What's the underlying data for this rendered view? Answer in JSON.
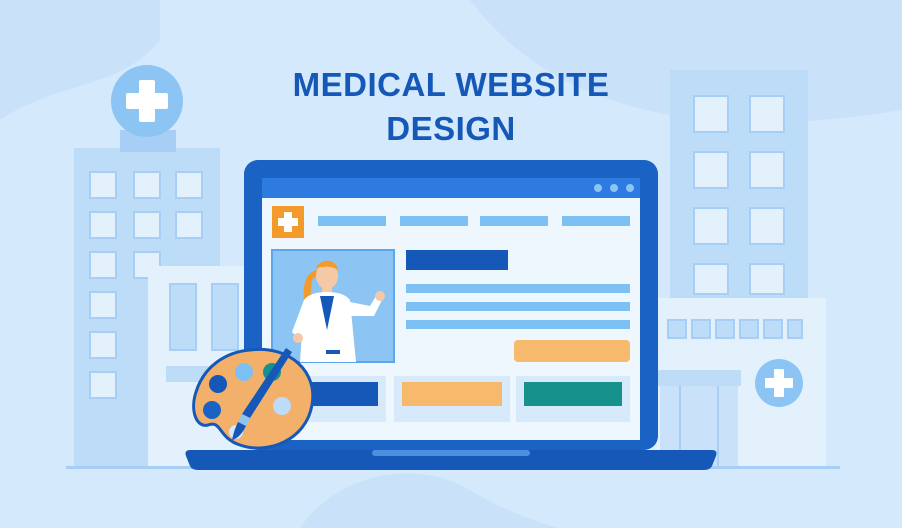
{
  "title": {
    "line1": "MEDICAL WEBSITE",
    "line2": "DESIGN"
  },
  "colors": {
    "background": "#d4e9fb",
    "title": "#1558b8",
    "laptop_frame": "#1a63c4",
    "browser_bar": "#2d7be0",
    "screen": "#eef6fe",
    "logo_orange": "#f39a2a",
    "nav_blue": "#7cc0f4",
    "heading_block": "#1558b8",
    "cta_orange": "#f7b96b",
    "card_teal": "#17918c",
    "building_light": "#bcdcf8",
    "building_window": "#e3f1fd",
    "palette": "#f2b06a"
  },
  "icons": [
    "hospital-cross-icon",
    "paint-palette-icon",
    "paintbrush-icon",
    "doctor-illustration",
    "window-dots-icon"
  ]
}
